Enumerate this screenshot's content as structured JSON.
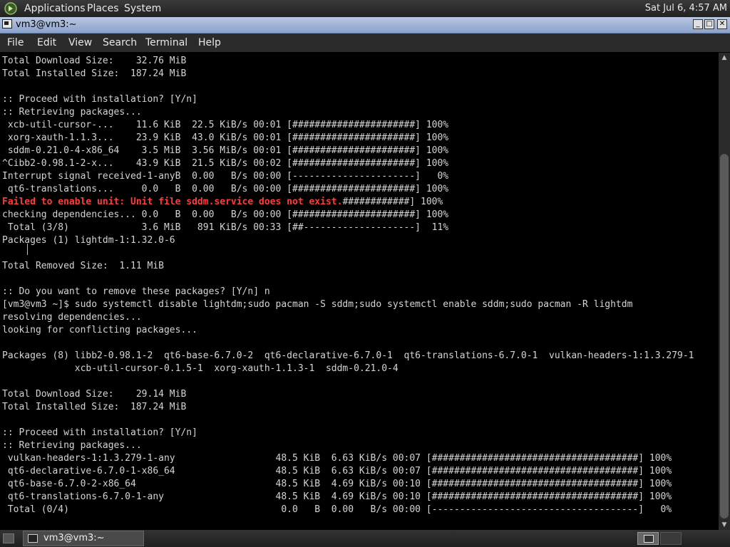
{
  "top_panel": {
    "menus": [
      "Applications",
      "Places",
      "System"
    ],
    "clock": "Sat Jul  6,  4:57 AM"
  },
  "window": {
    "title": "vm3@vm3:~",
    "controls": {
      "minimize": "_",
      "maximize": "□",
      "close": "✕"
    }
  },
  "menubar": [
    "File",
    "Edit",
    "View",
    "Search",
    "Terminal",
    "Help"
  ],
  "terminal": {
    "lines": [
      "Total Download Size:    32.76 MiB",
      "Total Installed Size:  187.24 MiB",
      "",
      ":: Proceed with installation? [Y/n]",
      ":: Retrieving packages...",
      " xcb-util-cursor-...    11.6 KiB  22.5 KiB/s 00:01 [######################] 100%",
      " xorg-xauth-1.1.3...    23.9 KiB  43.0 KiB/s 00:01 [######################] 100%",
      " sddm-0.21.0-4-x86_64    3.5 MiB  3.56 MiB/s 00:01 [######################] 100%",
      "^Cibb2-0.98.1-2-x...    43.9 KiB  21.5 KiB/s 00:02 [######################] 100%",
      "Interrupt signal received-1-anyB  0.00   B/s 00:00 [----------------------]   0%",
      " qt6-translations...     0.0   B  0.00   B/s 00:00 [######################] 100%",
      "Failed to enable unit: Unit file sddm.service does not exist.############] 100%",
      "checking dependencies... 0.0   B  0.00   B/s 00:00 [######################] 100%",
      " Total (3/8)             3.6 MiB   891 KiB/s 00:33 [##--------------------]  11%",
      "Packages (1) lightdm-1:1.32.0-6",
      "",
      "Total Removed Size:  1.11 MiB",
      "",
      ":: Do you want to remove these packages? [Y/n] n",
      "[vm3@vm3 ~]$ sudo systemctl disable lightdm;sudo pacman -S sddm;sudo systemctl enable sddm;sudo pacman -R lightdm",
      "resolving dependencies...",
      "looking for conflicting packages...",
      "",
      "Packages (8) libb2-0.98.1-2  qt6-base-6.7.0-2  qt6-declarative-6.7.0-1  qt6-translations-6.7.0-1  vulkan-headers-1:1.3.279-1",
      "             xcb-util-cursor-0.1.5-1  xorg-xauth-1.1.3-1  sddm-0.21.0-4",
      "",
      "Total Download Size:    29.14 MiB",
      "Total Installed Size:  187.24 MiB",
      "",
      ":: Proceed with installation? [Y/n]",
      ":: Retrieving packages...",
      " vulkan-headers-1:1.3.279-1-any                  48.5 KiB  6.63 KiB/s 00:07 [#####################################] 100%",
      " qt6-declarative-6.7.0-1-x86_64                  48.5 KiB  6.63 KiB/s 00:07 [#####################################] 100%",
      " qt6-base-6.7.0-2-x86_64                         48.5 KiB  4.69 KiB/s 00:10 [#####################################] 100%",
      " qt6-translations-6.7.0-1-any                    48.5 KiB  4.69 KiB/s 00:10 [#####################################] 100%",
      " Total (0/4)                                      0.0   B  0.00   B/s 00:00 [-------------------------------------]   0%"
    ],
    "error_line_index": 11,
    "error_text": "Failed to enable unit: Unit file sddm.service does not exist.",
    "error_tail": "############] 100%",
    "colors": {
      "background": "#000000",
      "foreground": "#d4d4d4",
      "error": "#ff3b3b"
    }
  },
  "taskbar": {
    "task_label": "vm3@vm3:~"
  }
}
